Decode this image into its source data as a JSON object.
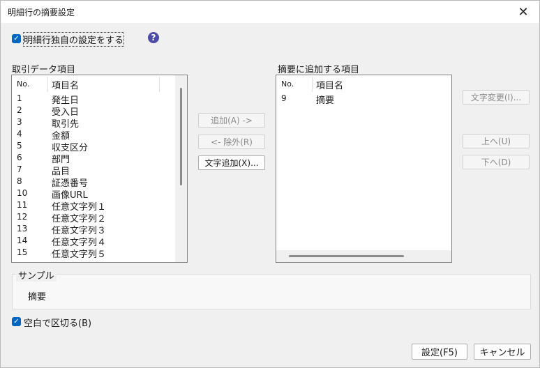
{
  "window": {
    "title": "明細行の摘要設定",
    "close_glyph": "✕"
  },
  "own_setting": {
    "label": "明細行独自の設定をする",
    "checked": true
  },
  "help": {
    "glyph": "?"
  },
  "source_list": {
    "label": "取引データ項目",
    "col_no": "No.",
    "col_name": "項目名",
    "rows": [
      {
        "no": "1",
        "name": "発生日"
      },
      {
        "no": "2",
        "name": "受入日"
      },
      {
        "no": "3",
        "name": "取引先"
      },
      {
        "no": "4",
        "name": "金額"
      },
      {
        "no": "5",
        "name": "収支区分"
      },
      {
        "no": "6",
        "name": "部門"
      },
      {
        "no": "7",
        "name": "品目"
      },
      {
        "no": "8",
        "name": "証憑番号"
      },
      {
        "no": "10",
        "name": "画像URL"
      },
      {
        "no": "11",
        "name": "任意文字列１"
      },
      {
        "no": "12",
        "name": "任意文字列２"
      },
      {
        "no": "13",
        "name": "任意文字列３"
      },
      {
        "no": "14",
        "name": "任意文字列４"
      },
      {
        "no": "15",
        "name": "任意文字列５"
      }
    ]
  },
  "middle_buttons": {
    "add": "追加(A) ->",
    "remove": "<- 除外(R)",
    "add_text": "文字追加(X)..."
  },
  "target_list": {
    "label": "摘要に追加する項目",
    "col_no": "No.",
    "col_name": "項目名",
    "rows": [
      {
        "no": "9",
        "name": "摘要"
      }
    ]
  },
  "right_buttons": {
    "change_text": "文字変更(I)...",
    "up": "上へ(U)",
    "down": "下へ(D)"
  },
  "sample": {
    "legend": "サンプル",
    "text": "摘要"
  },
  "space_separate": {
    "label": "空白で区切る(B)",
    "checked": true
  },
  "footer": {
    "ok": "設定(F5)",
    "cancel": "キャンセル"
  },
  "colors": {
    "accent": "#0067c0",
    "help": "#4c4ca6"
  }
}
